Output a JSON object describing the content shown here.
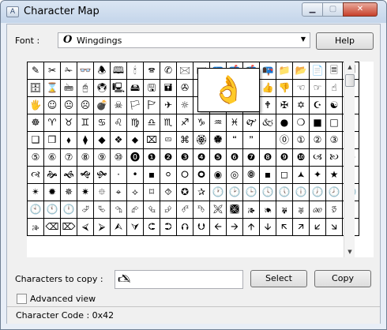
{
  "window": {
    "title": "Character Map",
    "close_glyph": "✕",
    "minimize_glyph": "▁",
    "maximize_glyph": "▢"
  },
  "font_row": {
    "label": "Font :",
    "selected_font": "Wingdings",
    "font_glyph": "O",
    "help_label": "Help"
  },
  "grid": {
    "columns": 20,
    "rows": 11,
    "cells": [
      "✎",
      "✂",
      "✁",
      "👓",
      "🕭",
      "🕮",
      "🕯",
      "🕿",
      "✆",
      "🖂",
      "🖃",
      "📪",
      "📫",
      "📬",
      "📭",
      "📁",
      "📂",
      "📄",
      "🗏",
      "🗐",
      "🗄",
      "⌛",
      "🖮",
      "🖰",
      "🖲",
      "🖳",
      "🖴",
      "🖫",
      "🖬",
      "✇",
      "✍",
      "🖎",
      "✌",
      "👌",
      "👍",
      "👎",
      "☜",
      "☞",
      "☝",
      "☟",
      "🖐",
      "☺",
      "😐",
      "☹",
      "💣",
      "☠",
      "🏳",
      "🏱",
      "✈",
      "☼",
      "💧",
      "❄",
      "🕆",
      "✞",
      "🕈",
      "✠",
      "✡",
      "☪",
      "☯",
      "ॐ",
      "☸",
      "♈",
      "♉",
      "♊",
      "♋",
      "♌",
      "♍",
      "♎",
      "♏",
      "♐",
      "♑",
      "♒",
      "♓",
      "🙰",
      "🙵",
      "●",
      "❍",
      "■",
      "□",
      "◻",
      "❑",
      "❒",
      "⬧",
      "⧫",
      "◆",
      "❖",
      "⬥",
      "⌧",
      "⮹",
      "⌘",
      "🏵",
      "🏶",
      "🙶",
      "🙷",
      " ",
      "⓪",
      "①",
      "②",
      "③",
      "④",
      "⑤",
      "⑥",
      "⑦",
      "⑧",
      "⑨",
      "⑩",
      "⓿",
      "❶",
      "❷",
      "❸",
      "❹",
      "❺",
      "❻",
      "❼",
      "❽",
      "❾",
      "❿",
      "🙢",
      "🙠",
      "🙡",
      "🙣",
      "🙞",
      "🙜",
      "🙝",
      "🙟",
      "·",
      "•",
      "▪",
      "⚪",
      "🞆",
      "🞈",
      "◉",
      "◎",
      "🞋",
      "▪",
      "◻",
      "🟂",
      "✦",
      "★",
      "✶",
      "✴",
      "✹",
      "✵",
      "✷",
      "⯐",
      "⌖",
      "⟡",
      "⌑",
      "⯑",
      "✪",
      "✰",
      "🕐",
      "🕑",
      "🕒",
      "🕓",
      "🕔",
      "🕕",
      "🕖",
      "🕗",
      "🕘",
      "🕙",
      "🕚",
      "🕛",
      "⮰",
      "⮱",
      "⮲",
      "⮳",
      "⮴",
      "⮵",
      "⮶",
      "⮷",
      "🙪",
      "🙫",
      "🙕",
      "🙔",
      "🙗",
      "🙖",
      "🙐",
      "🙑",
      "🙒",
      "🙓",
      "⌫",
      "⌦",
      "⮘",
      "⮚",
      "⮙",
      "⮛",
      "⮈",
      "⮊",
      "⮉",
      "⮋",
      "🡨",
      "🡪",
      "🡩",
      "🡫",
      "🡬",
      "🡭",
      "🡯",
      "🡮",
      "🡸"
    ]
  },
  "zoom": {
    "glyph": "👌"
  },
  "copy_row": {
    "label": "Characters to copy :",
    "value": "🖎",
    "select_label": "Select",
    "copy_label": "Copy"
  },
  "advanced": {
    "label": "Advanced view",
    "checked": false
  },
  "status": {
    "text": "Character Code : 0x42"
  },
  "colors": {
    "title_bar": "#c4d5ea",
    "close_button": "#c7402a",
    "client_bg": "#f0f0f0"
  }
}
